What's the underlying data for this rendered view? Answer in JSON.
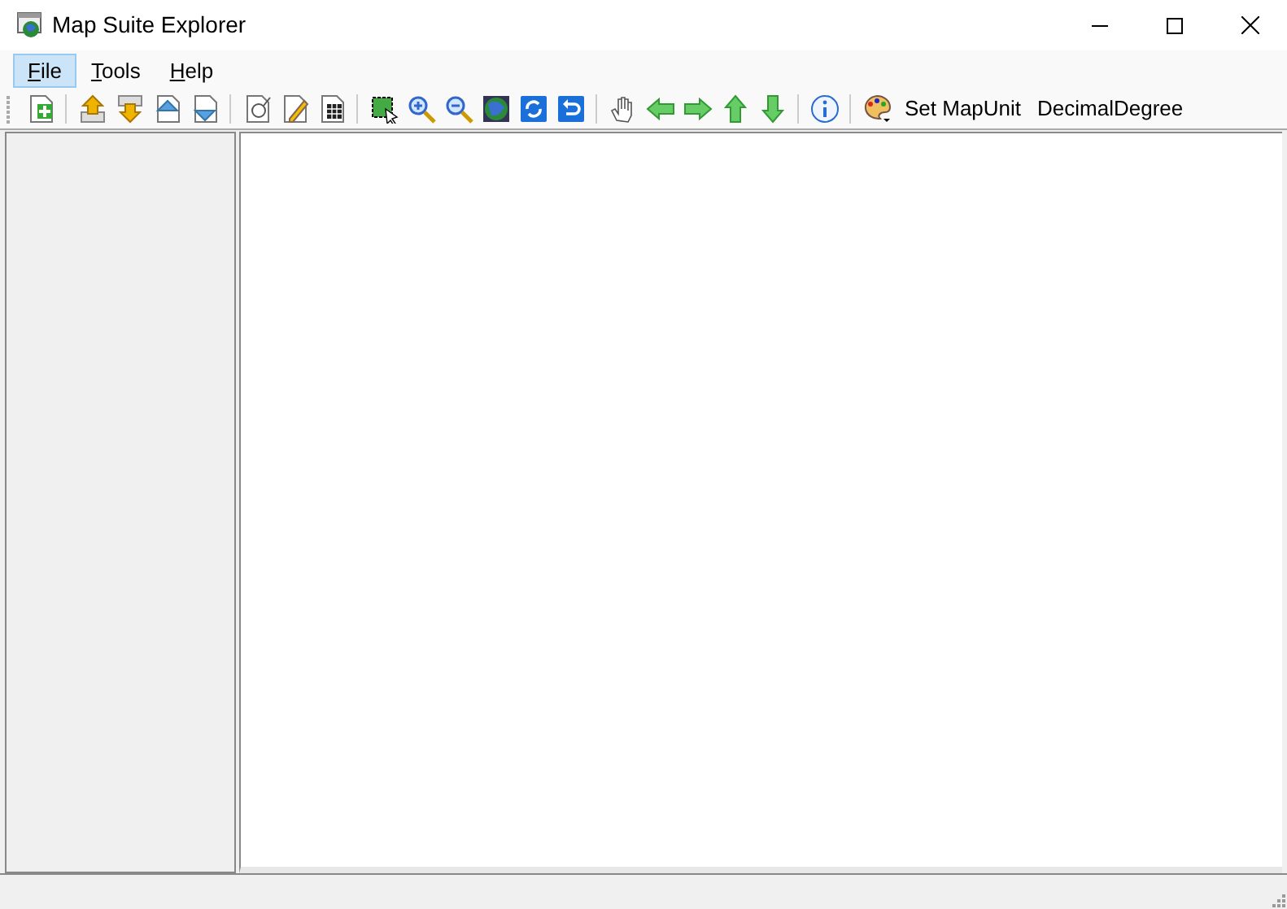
{
  "window": {
    "title": "Map Suite Explorer"
  },
  "menu": [
    {
      "label": "File",
      "selected": true
    },
    {
      "label": "Tools",
      "selected": false
    },
    {
      "label": "Help",
      "selected": false
    }
  ],
  "toolbar": {
    "set_map_unit": "Set MapUnit",
    "map_unit": "DecimalDegree"
  }
}
